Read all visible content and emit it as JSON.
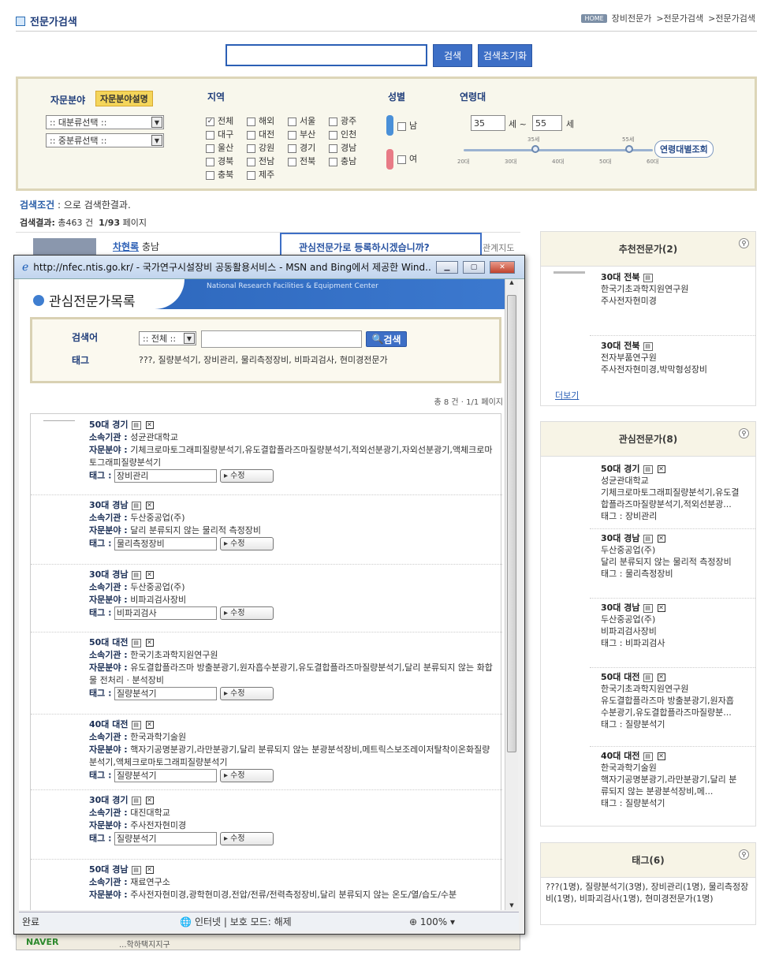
{
  "header": {
    "title": "전문가검색",
    "home": "HOME",
    "breadcrumb": [
      "장비전문가",
      ">전문가검색",
      ">전문가검색"
    ]
  },
  "search": {
    "button": "검색",
    "reset": "검색초기화"
  },
  "filter": {
    "field_label": "자문분야",
    "field_help": "자문분야설명",
    "major_select": ":: 대분류선택 ::",
    "minor_select": ":: 중분류선택 ::",
    "region_label": "지역",
    "regions": [
      "전체",
      "해외",
      "서울",
      "광주",
      "대구",
      "대전",
      "부산",
      "인천",
      "울산",
      "강원",
      "경기",
      "경남",
      "경북",
      "전남",
      "전북",
      "충남",
      "충북",
      "제주"
    ],
    "gender_label": "성별",
    "male": "남",
    "female": "여",
    "age_label": "연령대",
    "age_from": "35",
    "age_to": "55",
    "age_sep": "세 ~",
    "age_unit": "세",
    "knob1": "35세",
    "knob2": "55세",
    "ticks": [
      "20대",
      "30대",
      "40대",
      "50대",
      "60대"
    ],
    "age_button": "연령대별조회"
  },
  "results": {
    "cond_label": "검색조건",
    "cond_text": ": 으로 검색한결과.",
    "count_label": "검색결과:",
    "count_text": "총463 건",
    "page_text": "1/93",
    "page_unit": "페이지"
  },
  "first_result": {
    "name": "차현록",
    "region": "충남",
    "register": "관심전문가로 등록하시겠습니까?",
    "map": "관계지도"
  },
  "recommend": {
    "title": "추천전문가(2)",
    "items": [
      {
        "head": "30대 전북",
        "org": "한국기초과학지원연구원",
        "field": "주사전자현미경"
      },
      {
        "head": "30대 전북",
        "org": "전자부품연구원",
        "field": "주사전자현미경,박막형성장비"
      }
    ],
    "more": "더보기"
  },
  "interest": {
    "title": "관심전문가(8)",
    "items": [
      {
        "head": "50대 경기",
        "org": "성균관대학교",
        "field1": "기체크로마토그래피질량분석기,유도결",
        "field2": "합플라즈마질량분석기,적외선분광...",
        "tag": "태그 : 장비관리"
      },
      {
        "head": "30대 경남",
        "org": "두산중공업(주)",
        "field1": "달리 분류되지 않는 물리적 측정장비",
        "field2": "",
        "tag": "태그 : 물리측정장비"
      },
      {
        "head": "30대 경남",
        "org": "두산중공업(주)",
        "field1": "비파괴검사장비",
        "field2": "",
        "tag": "태그 : 비파괴검사"
      },
      {
        "head": "50대 대전",
        "org": "한국기초과학지원연구원",
        "field1": "유도결합플라즈마 방출분광기,원자흡",
        "field2": "수분광기,유도결합플라즈마질량분...",
        "tag": "태그 : 질량분석기"
      },
      {
        "head": "40대 대전",
        "org": "한국과학기술원",
        "field1": "핵자기공명분광기,라만분광기,달리 분",
        "field2": "류되지 않는 분광분석장비,메...",
        "tag": "태그 : 질량분석기"
      }
    ]
  },
  "tags": {
    "title": "태그(6)",
    "text": "???(1명), 질량분석기(3명), 장비관리(1명), 물리측정장비(1명), 비파괴검사(1명), 현미경전문가(1명)"
  },
  "popup": {
    "title": "http://nfec.ntis.go.kr/ - 국가연구시설장비 공동활용서비스 - MSN and Bing에서 제공한 Wind...",
    "banner_en": "National Research Facilities & Equipment Center",
    "heading": "관심전문가목록",
    "search_label": "검색어",
    "search_select": ":: 전체 ::",
    "search_btn": "검색",
    "tag_label": "태그",
    "tag_list": "???, 질량분석기, 장비관리, 물리측정장비, 비파괴검사, 현미경전문가",
    "count": "총 8 건 · 1/1 페이지",
    "org_label": "소속기관 :",
    "field_label": "자문분야 :",
    "tag_field_label": "태그 :",
    "edit": "수정",
    "items": [
      {
        "head": "50대 경기",
        "org": "성균관대학교",
        "field": "기체크로마토그래피질량분석기,유도결합플라즈마질량분석기,적외선분광기,자외선분광기,액체크로마토그래피질량분석기",
        "tag": "장비관리"
      },
      {
        "head": "30대 경남",
        "org": "두산중공업(주)",
        "field": "달리 분류되지 않는 물리적 측정장비",
        "tag": "물리측정장비"
      },
      {
        "head": "30대 경남",
        "org": "두산중공업(주)",
        "field": "비파괴검사장비",
        "tag": "비파괴검사"
      },
      {
        "head": "50대 대전",
        "org": "한국기초과학지원연구원",
        "field": "유도결합플라즈마 방출분광기,원자흡수분광기,유도결합플라즈마질량분석기,달리 분류되지 않는 화합물 전처리 · 분석장비",
        "tag": "질량분석기"
      },
      {
        "head": "40대 대전",
        "org": "한국과학기술원",
        "field": "핵자기공명분광기,라만분광기,달리 분류되지 않는 분광분석장비,메트릭스보조레이저탈착이온화질량분석기,액체크로마토그래피질량분석기",
        "tag": "질량분석기"
      },
      {
        "head": "30대 경기",
        "org": "대진대학교",
        "field": "주사전자현미경",
        "tag": "질량분석기"
      },
      {
        "head": "50대 경남",
        "org": "재료연구소",
        "field": "주사전자현미경,광학현미경,전압/전류/전력측정장비,달리 분류되지 않는 온도/열/습도/수분",
        "tag": ""
      }
    ],
    "status": {
      "done": "완료",
      "zone": "인터넷 | 보호 모드: 해제",
      "zoom": "100%"
    }
  },
  "map": {
    "label": "NAVER",
    "place": "...학하택지지구"
  }
}
